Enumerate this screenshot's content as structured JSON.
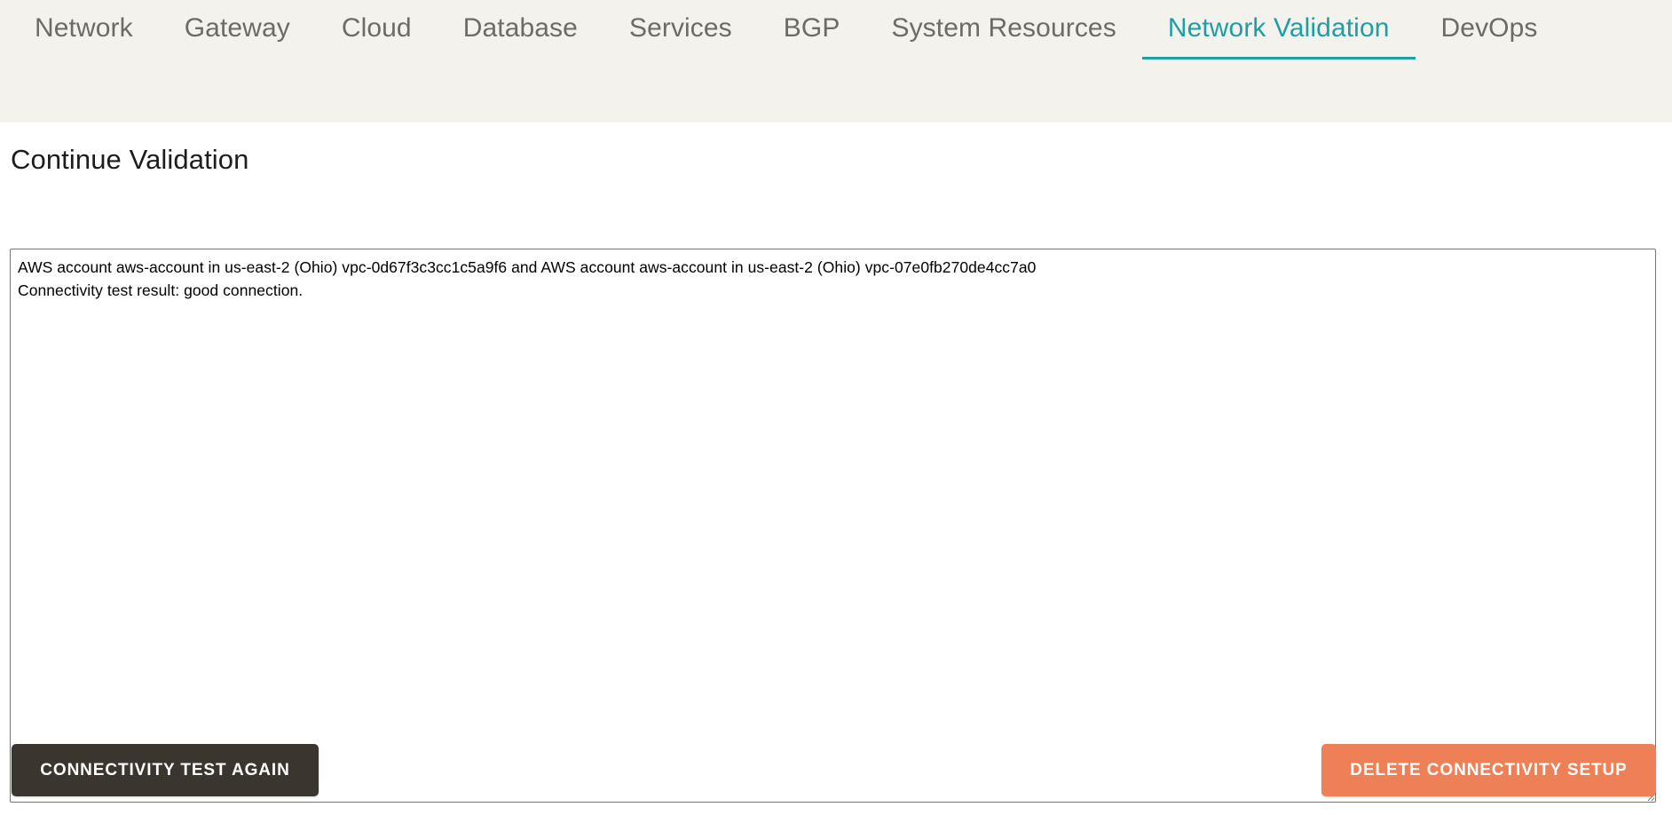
{
  "nav": {
    "tabs": [
      {
        "label": "Network",
        "active": false
      },
      {
        "label": "Gateway",
        "active": false
      },
      {
        "label": "Cloud",
        "active": false
      },
      {
        "label": "Database",
        "active": false
      },
      {
        "label": "Services",
        "active": false
      },
      {
        "label": "BGP",
        "active": false
      },
      {
        "label": "System Resources",
        "active": false
      },
      {
        "label": "Network Validation",
        "active": true
      },
      {
        "label": "DevOps",
        "active": false
      }
    ],
    "active_tab": "Network Validation",
    "background_color": "#f3f2ed",
    "active_color": "#1f9ea4",
    "inactive_color": "#6b6b67"
  },
  "main": {
    "page_title": "Continue Validation",
    "validation_output": {
      "value": "AWS account aws-account in us-east-2 (Ohio) vpc-0d67f3c3cc1c5a9f6 and AWS account aws-account in us-east-2 (Ohio) vpc-07e0fb270de4cc7a0\nConnectivity test result: good connection.",
      "placeholder": "",
      "lines": [
        "AWS account aws-account in us-east-2 (Ohio) vpc-0d67f3c3cc1c5a9f6 and AWS account aws-account in us-east-2 (Ohio) vpc-07e0fb270de4cc7a0",
        "Connectivity test result: good connection."
      ],
      "details": {
        "account_1": "aws-account",
        "region_1": "us-east-2 (Ohio)",
        "vpc_1": "vpc-0d67f3c3cc1c5a9f6",
        "account_2": "aws-account",
        "region_2": "us-east-2 (Ohio)",
        "vpc_2": "vpc-07e0fb270de4cc7a0",
        "test_result": "good connection."
      }
    }
  },
  "footer": {
    "connectivity_test_again_label": "CONNECTIVITY TEST AGAIN",
    "delete_connectivity_setup_label": "DELETE CONNECTIVITY SETUP",
    "primary_button_color": "#3a352e",
    "danger_button_color": "#ee8057"
  }
}
